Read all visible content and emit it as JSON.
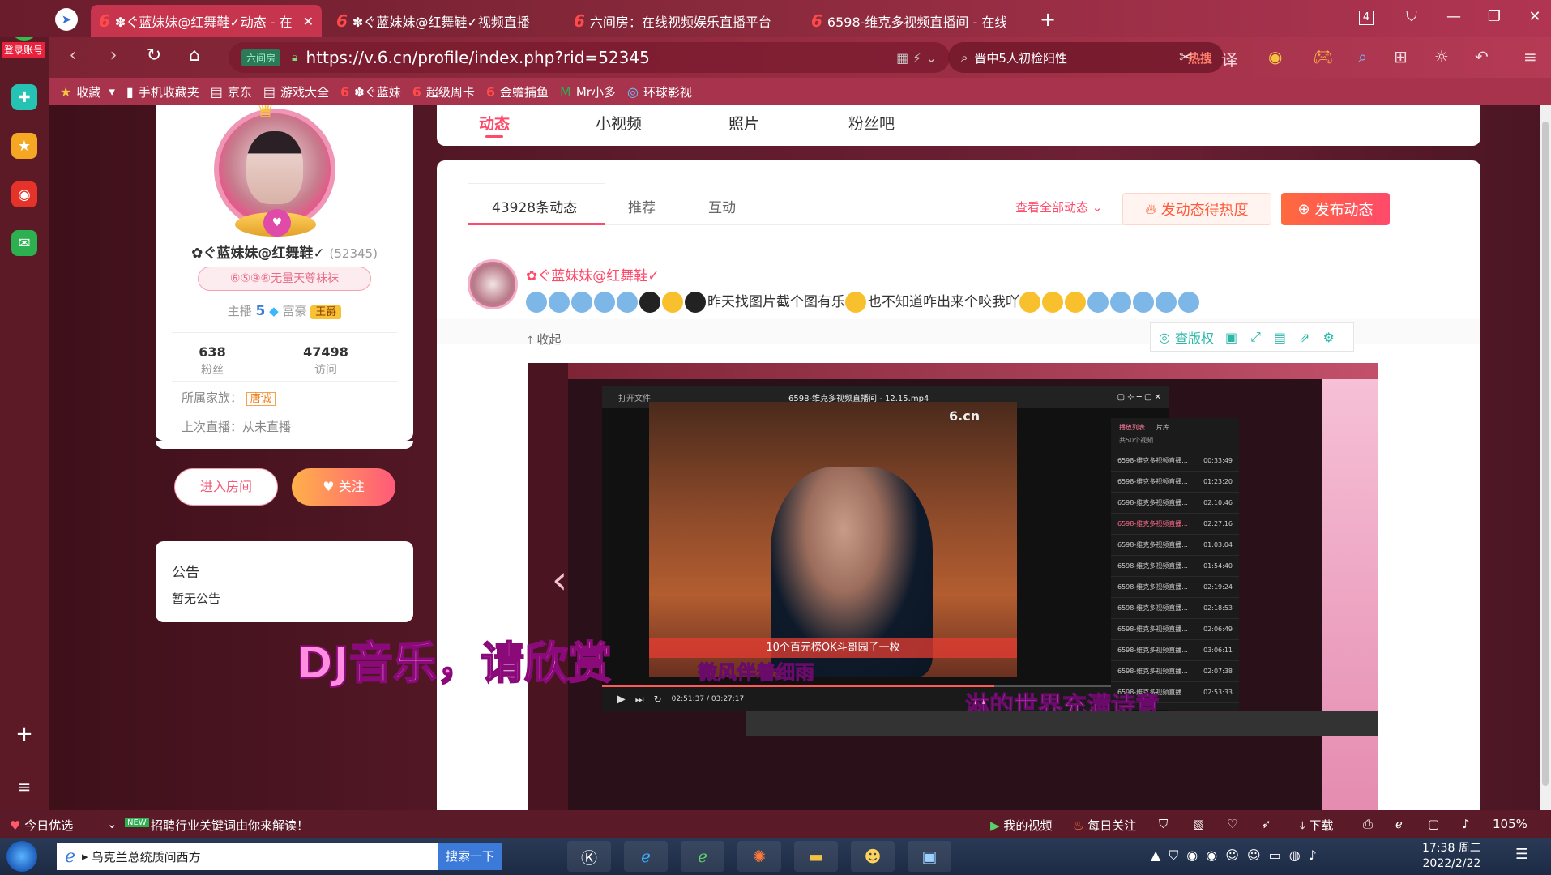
{
  "browser": {
    "tabs": [
      {
        "label": "✽ぐ蓝妹妹@红舞鞋✓动态 - 在",
        "active": true
      },
      {
        "label": "✽ぐ蓝妹妹@红舞鞋✓视频直播",
        "active": false
      },
      {
        "label": "六间房：在线视频娱乐直播平台",
        "active": false
      },
      {
        "label": "6598-维克多视频直播间 - 在线",
        "active": false
      }
    ],
    "new_tab": "+",
    "tab_count": "4",
    "url": "https://v.6.cn/profile/index.php?rid=52345",
    "site_badge": "六间房",
    "search_text": "晋中5人初检阳性",
    "search_hot": "热搜",
    "login_label": "登录账号"
  },
  "bookmarks": [
    {
      "label": "收藏",
      "icon": "star-icon"
    },
    {
      "label": "手机收藏夹",
      "icon": "phone-icon"
    },
    {
      "label": "京东",
      "icon": "page-icon"
    },
    {
      "label": "游戏大全",
      "icon": "page-icon"
    },
    {
      "label": "✽ぐ蓝妹",
      "icon": "six-icon"
    },
    {
      "label": "超级周卡",
      "icon": "six-icon"
    },
    {
      "label": "金蟾捕鱼",
      "icon": "six-icon"
    },
    {
      "label": "Mr小多",
      "icon": "mr-icon"
    },
    {
      "label": "环球影视",
      "icon": "globe-icon"
    }
  ],
  "profile": {
    "name": "✿ぐ蓝妹妹@红舞鞋✓",
    "rid": "(52345)",
    "tagline": "⑥⑤⑨⑧无量天尊袜袜",
    "anchor_label": "主播",
    "anchor_level": "5",
    "rich_label": "富豪",
    "rich_level": "王爵",
    "fans_count": "638",
    "fans_label": "粉丝",
    "visits_count": "47498",
    "visits_label": "访问",
    "family_label": "所属家族：",
    "family_value": "唐诚",
    "last_live": "上次直播：从未直播",
    "enter_room": "进入房间",
    "follow": "关注"
  },
  "notice": {
    "title": "公告",
    "body": "暂无公告"
  },
  "top_tabs": [
    "动态",
    "小视频",
    "照片",
    "粉丝吧"
  ],
  "feed": {
    "tabs": [
      "43928条动态",
      "推荐",
      "互动"
    ],
    "view_all": "查看全部动态",
    "hot_button": "发动态得热度",
    "publish_button": "发布动态",
    "post_author": "✿ぐ蓝妹妹@红舞鞋✓",
    "post_text_1": "昨天找图片截个图有乐",
    "post_text_2": "也不知道咋出来个咬我吖",
    "collapse": "收起",
    "copyright": "查版权"
  },
  "embedded": {
    "player_title": "6598-维克多视频直播间 - 12.15.mp4",
    "player_open": "打开文件",
    "watermark": "6.cn",
    "caption_bar": "10个百元榜OK斗哥园子一枚",
    "lyric_1": "微风伴着细雨",
    "lyric_2": "淋的世界充满诗意",
    "big_caption": "DJ音乐，请欣赏",
    "time": "02:51:37 / 03:27:17",
    "playlist_tabs": [
      "播放列表",
      "片库"
    ],
    "playlist_count": "共50个视频",
    "playlist": [
      {
        "title": "6598-维克多视频直播...",
        "dur": "00:33:49"
      },
      {
        "title": "6598-维克多视频直播...",
        "dur": "01:23:20"
      },
      {
        "title": "6598-维克多视频直播...",
        "dur": "02:10:46"
      },
      {
        "title": "6598-维克多视频直播...",
        "dur": "02:27:16"
      },
      {
        "title": "6598-维克多视频直播...",
        "dur": "01:03:04"
      },
      {
        "title": "6598-维克多视频直播...",
        "dur": "01:54:40"
      },
      {
        "title": "6598-维克多视频直播...",
        "dur": "02:19:24"
      },
      {
        "title": "6598-维克多视频直播...",
        "dur": "02:18:53"
      },
      {
        "title": "6598-维克多视频直播...",
        "dur": "02:06:49"
      },
      {
        "title": "6598-维克多视频直播...",
        "dur": "03:06:11"
      },
      {
        "title": "6598-维克多视频直播...",
        "dur": "02:07:38"
      },
      {
        "title": "6598-维克多视频直播...",
        "dur": "02:53:33"
      }
    ]
  },
  "statusbar": {
    "today": "今日优选",
    "new_badge": "NEW",
    "news": "招聘行业关键词由你来解读！",
    "my_video": "我的视频",
    "daily": "每日关注",
    "download": "下载",
    "zoom": "105%"
  },
  "taskbar": {
    "search_text": "乌克兰总统质问西方",
    "search_button": "搜索一下",
    "time": "17:38 周二",
    "date": "2022/2/22"
  },
  "colors": {
    "accent": "#ff4a6a",
    "orange": "#ff6a3d",
    "titlebar": "#8c2a3d"
  }
}
